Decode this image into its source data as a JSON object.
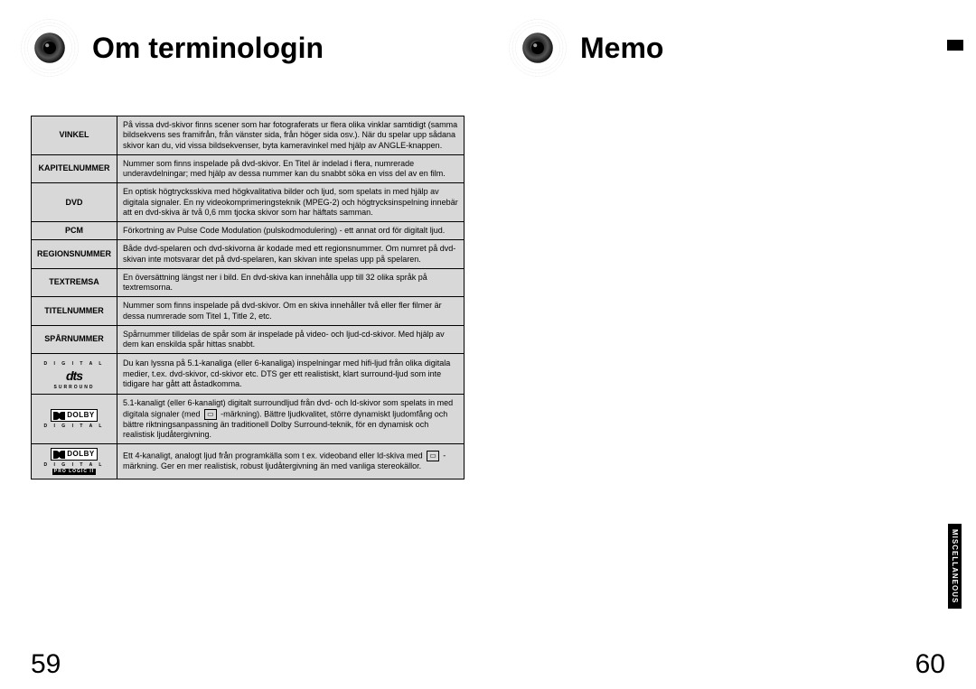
{
  "left": {
    "title": "Om terminologin",
    "pageNumber": "59",
    "terms": [
      {
        "label": "VINKEL",
        "definition": "På vissa dvd-skivor finns scener som har fotograferats ur flera olika vinklar samtidigt (samma bildsekvens ses framifrån, från vänster sida, från höger sida osv.). När du spelar upp sådana skivor kan du, vid vissa bildsekvenser, byta kameravinkel med hjälp av ANGLE-knappen."
      },
      {
        "label": "KAPITELNUMMER",
        "definition": "Nummer som finns inspelade på dvd-skivor. En Titel är indelad i flera, numrerade underavdelningar; med hjälp av dessa nummer kan du snabbt söka en viss del av en film."
      },
      {
        "label": "DVD",
        "definition": "En optisk högtrycksskiva med högkvalitativa bilder och ljud, som spelats in med hjälp av digitala signaler. En ny videokomprimeringsteknik (MPEG-2) och högtrycksinspelning innebär att en dvd-skiva är två 0,6 mm tjocka skivor som har häftats samman."
      },
      {
        "label": "PCM",
        "definition": "Förkortning av Pulse Code Modulation (pulskodmodulering) - ett annat ord för digitalt ljud."
      },
      {
        "label": "REGIONSNUMMER",
        "definition": "Både dvd-spelaren och dvd-skivorna är kodade med ett regionsnummer. Om numret på dvd-skivan inte motsvarar det på dvd-spelaren, kan skivan inte spelas upp på spelaren."
      },
      {
        "label": "TEXTREMSA",
        "definition": "En översättning längst ner i bild. En dvd-skiva kan innehålla upp till 32 olika språk på textremsorna."
      },
      {
        "label": "TITELNUMMER",
        "definition": "Nummer som finns inspelade på dvd-skivor. Om en skiva innehåller två eller fler filmer är dessa numrerade som Titel 1, Title 2, etc."
      },
      {
        "label": "SPÅRNUMMER",
        "definition": "Spårnummer tilldelas de spår som är inspelade på video- och ljud-cd-skivor. Med hjälp av dem kan enskilda spår hittas snabbt."
      },
      {
        "labelLogo": "dts",
        "dts_top": "D I G I T A L",
        "dts_mid": "dts",
        "dts_bot": "SURROUND",
        "definition": "Du kan lyssna på 5.1-kanaliga (eller 6-kanaliga) inspelningar med hifi-ljud från olika digitala medier, t.ex. dvd-skivor, cd-skivor etc. DTS ger ett realistiskt, klart surround-ljud som inte tidigare har gått att åstadkomma."
      },
      {
        "labelLogo": "dolby-digital",
        "dolby_brand": "DOLBY",
        "dolby_sub": "D I G I T A L",
        "def_pre": "5.1-kanaligt (eller 6-kanaligt) digitalt surroundljud från dvd- och ld-skivor som spelats in med digitala signaler (med ",
        "def_post": " -märkning). Bättre ljudkvalitet, större dynamiskt ljudomfång och bättre riktningsanpassning än traditionell Dolby Surround-teknik, för en dynamisk och realistisk ljudåtergivning."
      },
      {
        "labelLogo": "dolby-prologic",
        "dolby_brand": "DOLBY",
        "dolby_sub": "D I G I T A L",
        "dolby_sub2": "PRO LOGIC II",
        "def_pre": "Ett 4-kanaligt, analogt ljud från programkälla som t ex. videoband eller ld-skiva med ",
        "def_post": " -märkning. Ger en mer realistisk, robust ljudåtergivning än med vanliga stereokällor."
      }
    ]
  },
  "right": {
    "title": "Memo",
    "pageNumber": "60",
    "sideTab": "MISCELLANEOUS"
  }
}
